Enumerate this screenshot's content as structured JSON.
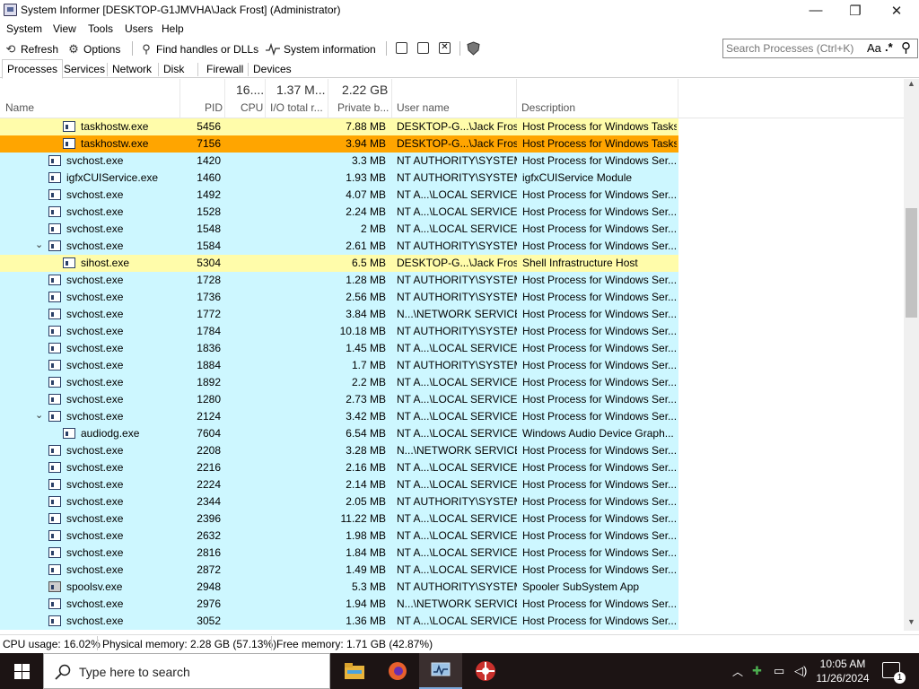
{
  "window": {
    "title": "System Informer [DESKTOP-G1JMVHA\\Jack Frost] (Administrator)",
    "minimize_glyph": "—",
    "maximize_glyph": "❐",
    "close_glyph": "✕"
  },
  "menu": [
    "System",
    "View",
    "Tools",
    "Users",
    "Help"
  ],
  "toolbar": {
    "refresh": "Refresh",
    "options": "Options",
    "find_handles": "Find handles or DLLs",
    "system_information": "System information"
  },
  "search": {
    "placeholder": "Search Processes (Ctrl+K)",
    "case_label": "Aa",
    "regex_label": ".*"
  },
  "tabs": [
    "Processes",
    "Services",
    "Network",
    "Disk",
    "Firewall",
    "Devices"
  ],
  "columns": {
    "name": "Name",
    "pid": "PID",
    "cpu_top": "16....",
    "cpu": "CPU",
    "io_top": "1.37 M...",
    "io": "I/O total r...",
    "private_top": "2.22 GB",
    "private": "Private b...",
    "user": "User name",
    "description": "Description"
  },
  "rows": [
    {
      "name": "taskhostw.exe",
      "pid": "5456",
      "private": "7.88 MB",
      "user": "DESKTOP-G...\\Jack Frost",
      "desc": "Host Process for Windows Tasks",
      "level": 2,
      "expander": "",
      "color": "#fffcaa",
      "icon": "app"
    },
    {
      "name": "taskhostw.exe",
      "pid": "7156",
      "private": "3.94 MB",
      "user": "DESKTOP-G...\\Jack Frost",
      "desc": "Host Process for Windows Tasks",
      "level": 2,
      "expander": "",
      "color": "#ffa500",
      "icon": "app"
    },
    {
      "name": "svchost.exe",
      "pid": "1420",
      "private": "3.3 MB",
      "user": "NT AUTHORITY\\SYSTEM",
      "desc": "Host Process for Windows Ser...",
      "level": 1,
      "expander": "",
      "color": "#cdf7ff",
      "icon": "app"
    },
    {
      "name": "igfxCUIService.exe",
      "pid": "1460",
      "private": "1.93 MB",
      "user": "NT AUTHORITY\\SYSTEM",
      "desc": "igfxCUIService Module",
      "level": 1,
      "expander": "",
      "color": "#cdf7ff",
      "icon": "app"
    },
    {
      "name": "svchost.exe",
      "pid": "1492",
      "private": "4.07 MB",
      "user": "NT A...\\LOCAL SERVICE",
      "desc": "Host Process for Windows Ser...",
      "level": 1,
      "expander": "",
      "color": "#cdf7ff",
      "icon": "app"
    },
    {
      "name": "svchost.exe",
      "pid": "1528",
      "private": "2.24 MB",
      "user": "NT A...\\LOCAL SERVICE",
      "desc": "Host Process for Windows Ser...",
      "level": 1,
      "expander": "",
      "color": "#cdf7ff",
      "icon": "app"
    },
    {
      "name": "svchost.exe",
      "pid": "1548",
      "private": "2 MB",
      "user": "NT A...\\LOCAL SERVICE",
      "desc": "Host Process for Windows Ser...",
      "level": 1,
      "expander": "",
      "color": "#cdf7ff",
      "icon": "app"
    },
    {
      "name": "svchost.exe",
      "pid": "1584",
      "private": "2.61 MB",
      "user": "NT AUTHORITY\\SYSTEM",
      "desc": "Host Process for Windows Ser...",
      "level": 1,
      "expander": "⌄",
      "color": "#cdf7ff",
      "icon": "app"
    },
    {
      "name": "sihost.exe",
      "pid": "5304",
      "private": "6.5 MB",
      "user": "DESKTOP-G...\\Jack Frost",
      "desc": "Shell Infrastructure Host",
      "level": 2,
      "expander": "",
      "color": "#fffcaa",
      "icon": "app"
    },
    {
      "name": "svchost.exe",
      "pid": "1728",
      "private": "1.28 MB",
      "user": "NT AUTHORITY\\SYSTEM",
      "desc": "Host Process for Windows Ser...",
      "level": 1,
      "expander": "",
      "color": "#cdf7ff",
      "icon": "app"
    },
    {
      "name": "svchost.exe",
      "pid": "1736",
      "private": "2.56 MB",
      "user": "NT AUTHORITY\\SYSTEM",
      "desc": "Host Process for Windows Ser...",
      "level": 1,
      "expander": "",
      "color": "#cdf7ff",
      "icon": "app"
    },
    {
      "name": "svchost.exe",
      "pid": "1772",
      "private": "3.84 MB",
      "user": "N...\\NETWORK SERVICE",
      "desc": "Host Process for Windows Ser...",
      "level": 1,
      "expander": "",
      "color": "#cdf7ff",
      "icon": "app"
    },
    {
      "name": "svchost.exe",
      "pid": "1784",
      "private": "10.18 MB",
      "user": "NT AUTHORITY\\SYSTEM",
      "desc": "Host Process for Windows Ser...",
      "level": 1,
      "expander": "",
      "color": "#cdf7ff",
      "icon": "app"
    },
    {
      "name": "svchost.exe",
      "pid": "1836",
      "private": "1.45 MB",
      "user": "NT A...\\LOCAL SERVICE",
      "desc": "Host Process for Windows Ser...",
      "level": 1,
      "expander": "",
      "color": "#cdf7ff",
      "icon": "app"
    },
    {
      "name": "svchost.exe",
      "pid": "1884",
      "private": "1.7 MB",
      "user": "NT AUTHORITY\\SYSTEM",
      "desc": "Host Process for Windows Ser...",
      "level": 1,
      "expander": "",
      "color": "#cdf7ff",
      "icon": "app"
    },
    {
      "name": "svchost.exe",
      "pid": "1892",
      "private": "2.2 MB",
      "user": "NT A...\\LOCAL SERVICE",
      "desc": "Host Process for Windows Ser...",
      "level": 1,
      "expander": "",
      "color": "#cdf7ff",
      "icon": "app"
    },
    {
      "name": "svchost.exe",
      "pid": "1280",
      "private": "2.73 MB",
      "user": "NT A...\\LOCAL SERVICE",
      "desc": "Host Process for Windows Ser...",
      "level": 1,
      "expander": "",
      "color": "#cdf7ff",
      "icon": "app"
    },
    {
      "name": "svchost.exe",
      "pid": "2124",
      "private": "3.42 MB",
      "user": "NT A...\\LOCAL SERVICE",
      "desc": "Host Process for Windows Ser...",
      "level": 1,
      "expander": "⌄",
      "color": "#cdf7ff",
      "icon": "app"
    },
    {
      "name": "audiodg.exe",
      "pid": "7604",
      "private": "6.54 MB",
      "user": "NT A...\\LOCAL SERVICE",
      "desc": "Windows Audio Device Graph...",
      "level": 2,
      "expander": "",
      "color": "#cdf7ff",
      "icon": "app"
    },
    {
      "name": "svchost.exe",
      "pid": "2208",
      "private": "3.28 MB",
      "user": "N...\\NETWORK SERVICE",
      "desc": "Host Process for Windows Ser...",
      "level": 1,
      "expander": "",
      "color": "#cdf7ff",
      "icon": "app"
    },
    {
      "name": "svchost.exe",
      "pid": "2216",
      "private": "2.16 MB",
      "user": "NT A...\\LOCAL SERVICE",
      "desc": "Host Process for Windows Ser...",
      "level": 1,
      "expander": "",
      "color": "#cdf7ff",
      "icon": "app"
    },
    {
      "name": "svchost.exe",
      "pid": "2224",
      "private": "2.14 MB",
      "user": "NT A...\\LOCAL SERVICE",
      "desc": "Host Process for Windows Ser...",
      "level": 1,
      "expander": "",
      "color": "#cdf7ff",
      "icon": "app"
    },
    {
      "name": "svchost.exe",
      "pid": "2344",
      "private": "2.05 MB",
      "user": "NT AUTHORITY\\SYSTEM",
      "desc": "Host Process for Windows Ser...",
      "level": 1,
      "expander": "",
      "color": "#cdf7ff",
      "icon": "app"
    },
    {
      "name": "svchost.exe",
      "pid": "2396",
      "private": "11.22 MB",
      "user": "NT A...\\LOCAL SERVICE",
      "desc": "Host Process for Windows Ser...",
      "level": 1,
      "expander": "",
      "color": "#cdf7ff",
      "icon": "app"
    },
    {
      "name": "svchost.exe",
      "pid": "2632",
      "private": "1.98 MB",
      "user": "NT A...\\LOCAL SERVICE",
      "desc": "Host Process for Windows Ser...",
      "level": 1,
      "expander": "",
      "color": "#cdf7ff",
      "icon": "app"
    },
    {
      "name": "svchost.exe",
      "pid": "2816",
      "private": "1.84 MB",
      "user": "NT A...\\LOCAL SERVICE",
      "desc": "Host Process for Windows Ser...",
      "level": 1,
      "expander": "",
      "color": "#cdf7ff",
      "icon": "app"
    },
    {
      "name": "svchost.exe",
      "pid": "2872",
      "private": "1.49 MB",
      "user": "NT A...\\LOCAL SERVICE",
      "desc": "Host Process for Windows Ser...",
      "level": 1,
      "expander": "",
      "color": "#cdf7ff",
      "icon": "app"
    },
    {
      "name": "spoolsv.exe",
      "pid": "2948",
      "private": "5.3 MB",
      "user": "NT AUTHORITY\\SYSTEM",
      "desc": "Spooler SubSystem App",
      "level": 1,
      "expander": "",
      "color": "#cdf7ff",
      "icon": "printer"
    },
    {
      "name": "svchost.exe",
      "pid": "2976",
      "private": "1.94 MB",
      "user": "N...\\NETWORK SERVICE",
      "desc": "Host Process for Windows Ser...",
      "level": 1,
      "expander": "",
      "color": "#cdf7ff",
      "icon": "app"
    },
    {
      "name": "svchost.exe",
      "pid": "3052",
      "private": "1.36 MB",
      "user": "NT A...\\LOCAL SERVICE",
      "desc": "Host Process for Windows Ser...",
      "level": 1,
      "expander": "",
      "color": "#cdf7ff",
      "icon": "app"
    }
  ],
  "status": {
    "cpu": "CPU usage: 16.02%",
    "physical": "Physical memory: 2.28 GB (57.13%)",
    "free": "Free memory: 1.71 GB (42.87%)"
  },
  "taskbar": {
    "search_placeholder": "Type here to search",
    "time": "10:05 AM",
    "date": "11/26/2024",
    "notification_count": "1"
  },
  "colors": {
    "service_row": "#cdf7ff",
    "user_row": "#fffcaa",
    "selected_row": "#ffa500",
    "taskbar": "#1c1414"
  }
}
